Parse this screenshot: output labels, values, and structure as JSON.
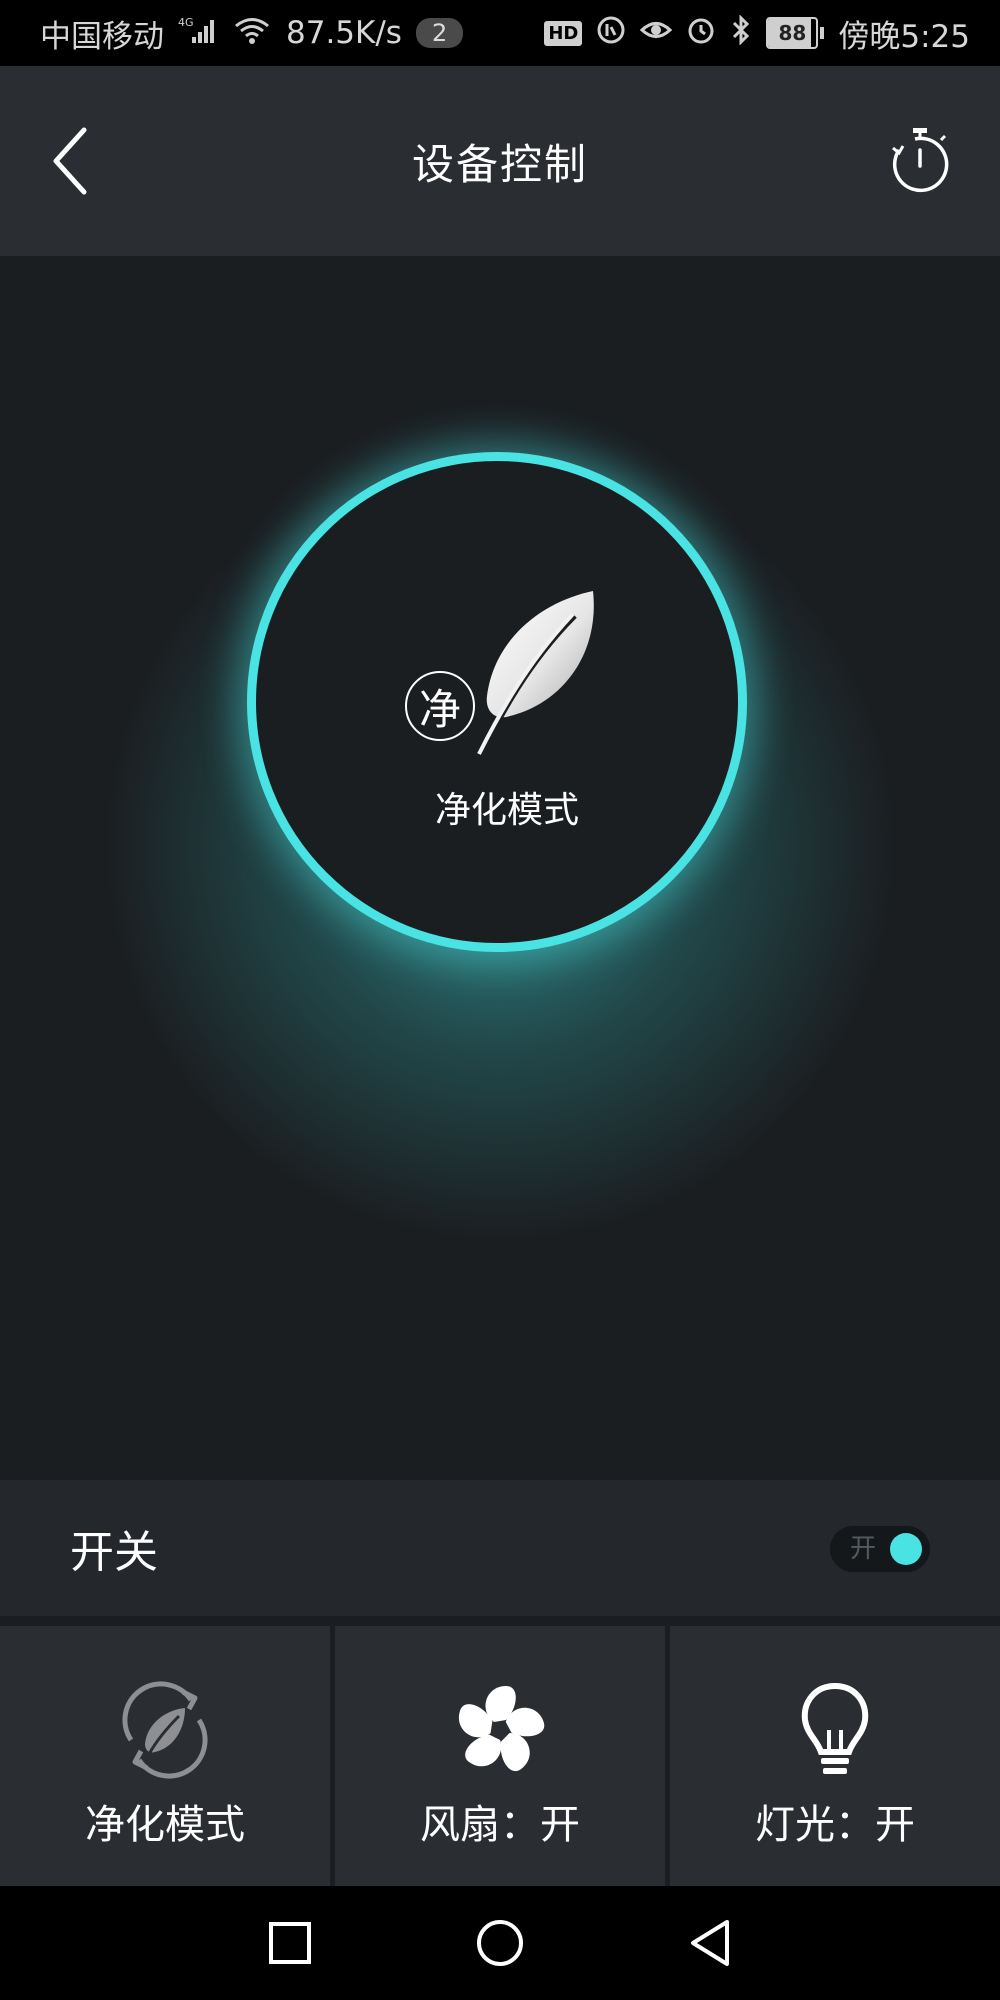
{
  "status_bar": {
    "carrier": "中国移动",
    "network": "4G",
    "speed": "87.5K/s",
    "notification_count": "2",
    "hd_badge": "HD",
    "battery": "88",
    "battery_level": 0.88,
    "time": "傍晚5:25"
  },
  "header": {
    "title": "设备控制",
    "back_icon": "chevron-left-icon",
    "timer_icon": "stopwatch-icon"
  },
  "main": {
    "mode_badge": "净",
    "mode_label": "净化模式",
    "accent_color": "#49e3e3"
  },
  "power": {
    "label": "开关",
    "toggle_text": "开",
    "is_on": true
  },
  "controls": [
    {
      "icon": "purify-leaf-icon",
      "label": "净化模式"
    },
    {
      "icon": "fan-icon",
      "label": "风扇：开"
    },
    {
      "icon": "lightbulb-icon",
      "label": "灯光：开"
    }
  ],
  "navbar": {
    "recent_icon": "square-icon",
    "home_icon": "circle-icon",
    "back_icon": "triangle-back-icon"
  }
}
